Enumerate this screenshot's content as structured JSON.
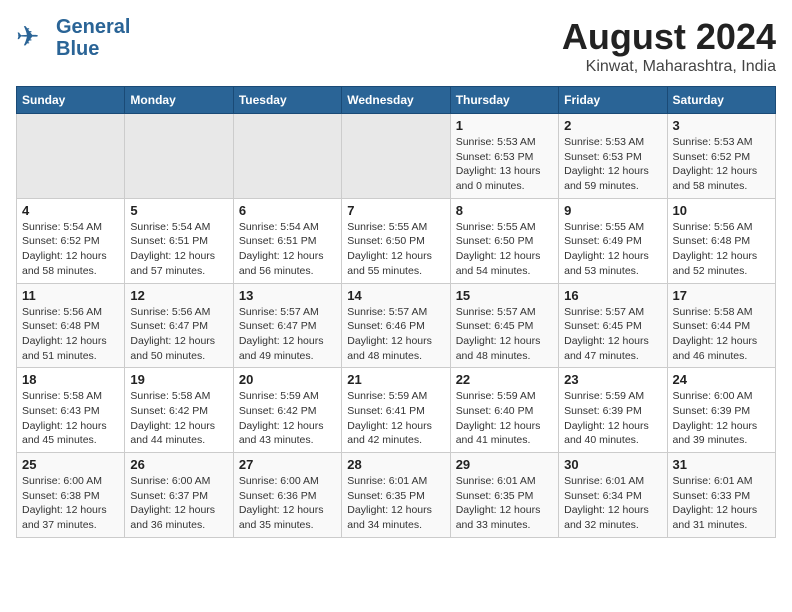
{
  "logo": {
    "line1": "General",
    "line2": "Blue"
  },
  "title": "August 2024",
  "subtitle": "Kinwat, Maharashtra, India",
  "weekdays": [
    "Sunday",
    "Monday",
    "Tuesday",
    "Wednesday",
    "Thursday",
    "Friday",
    "Saturday"
  ],
  "weeks": [
    [
      {
        "day": "",
        "info": ""
      },
      {
        "day": "",
        "info": ""
      },
      {
        "day": "",
        "info": ""
      },
      {
        "day": "",
        "info": ""
      },
      {
        "day": "1",
        "info": "Sunrise: 5:53 AM\nSunset: 6:53 PM\nDaylight: 13 hours\nand 0 minutes."
      },
      {
        "day": "2",
        "info": "Sunrise: 5:53 AM\nSunset: 6:53 PM\nDaylight: 12 hours\nand 59 minutes."
      },
      {
        "day": "3",
        "info": "Sunrise: 5:53 AM\nSunset: 6:52 PM\nDaylight: 12 hours\nand 58 minutes."
      }
    ],
    [
      {
        "day": "4",
        "info": "Sunrise: 5:54 AM\nSunset: 6:52 PM\nDaylight: 12 hours\nand 58 minutes."
      },
      {
        "day": "5",
        "info": "Sunrise: 5:54 AM\nSunset: 6:51 PM\nDaylight: 12 hours\nand 57 minutes."
      },
      {
        "day": "6",
        "info": "Sunrise: 5:54 AM\nSunset: 6:51 PM\nDaylight: 12 hours\nand 56 minutes."
      },
      {
        "day": "7",
        "info": "Sunrise: 5:55 AM\nSunset: 6:50 PM\nDaylight: 12 hours\nand 55 minutes."
      },
      {
        "day": "8",
        "info": "Sunrise: 5:55 AM\nSunset: 6:50 PM\nDaylight: 12 hours\nand 54 minutes."
      },
      {
        "day": "9",
        "info": "Sunrise: 5:55 AM\nSunset: 6:49 PM\nDaylight: 12 hours\nand 53 minutes."
      },
      {
        "day": "10",
        "info": "Sunrise: 5:56 AM\nSunset: 6:48 PM\nDaylight: 12 hours\nand 52 minutes."
      }
    ],
    [
      {
        "day": "11",
        "info": "Sunrise: 5:56 AM\nSunset: 6:48 PM\nDaylight: 12 hours\nand 51 minutes."
      },
      {
        "day": "12",
        "info": "Sunrise: 5:56 AM\nSunset: 6:47 PM\nDaylight: 12 hours\nand 50 minutes."
      },
      {
        "day": "13",
        "info": "Sunrise: 5:57 AM\nSunset: 6:47 PM\nDaylight: 12 hours\nand 49 minutes."
      },
      {
        "day": "14",
        "info": "Sunrise: 5:57 AM\nSunset: 6:46 PM\nDaylight: 12 hours\nand 48 minutes."
      },
      {
        "day": "15",
        "info": "Sunrise: 5:57 AM\nSunset: 6:45 PM\nDaylight: 12 hours\nand 48 minutes."
      },
      {
        "day": "16",
        "info": "Sunrise: 5:57 AM\nSunset: 6:45 PM\nDaylight: 12 hours\nand 47 minutes."
      },
      {
        "day": "17",
        "info": "Sunrise: 5:58 AM\nSunset: 6:44 PM\nDaylight: 12 hours\nand 46 minutes."
      }
    ],
    [
      {
        "day": "18",
        "info": "Sunrise: 5:58 AM\nSunset: 6:43 PM\nDaylight: 12 hours\nand 45 minutes."
      },
      {
        "day": "19",
        "info": "Sunrise: 5:58 AM\nSunset: 6:42 PM\nDaylight: 12 hours\nand 44 minutes."
      },
      {
        "day": "20",
        "info": "Sunrise: 5:59 AM\nSunset: 6:42 PM\nDaylight: 12 hours\nand 43 minutes."
      },
      {
        "day": "21",
        "info": "Sunrise: 5:59 AM\nSunset: 6:41 PM\nDaylight: 12 hours\nand 42 minutes."
      },
      {
        "day": "22",
        "info": "Sunrise: 5:59 AM\nSunset: 6:40 PM\nDaylight: 12 hours\nand 41 minutes."
      },
      {
        "day": "23",
        "info": "Sunrise: 5:59 AM\nSunset: 6:39 PM\nDaylight: 12 hours\nand 40 minutes."
      },
      {
        "day": "24",
        "info": "Sunrise: 6:00 AM\nSunset: 6:39 PM\nDaylight: 12 hours\nand 39 minutes."
      }
    ],
    [
      {
        "day": "25",
        "info": "Sunrise: 6:00 AM\nSunset: 6:38 PM\nDaylight: 12 hours\nand 37 minutes."
      },
      {
        "day": "26",
        "info": "Sunrise: 6:00 AM\nSunset: 6:37 PM\nDaylight: 12 hours\nand 36 minutes."
      },
      {
        "day": "27",
        "info": "Sunrise: 6:00 AM\nSunset: 6:36 PM\nDaylight: 12 hours\nand 35 minutes."
      },
      {
        "day": "28",
        "info": "Sunrise: 6:01 AM\nSunset: 6:35 PM\nDaylight: 12 hours\nand 34 minutes."
      },
      {
        "day": "29",
        "info": "Sunrise: 6:01 AM\nSunset: 6:35 PM\nDaylight: 12 hours\nand 33 minutes."
      },
      {
        "day": "30",
        "info": "Sunrise: 6:01 AM\nSunset: 6:34 PM\nDaylight: 12 hours\nand 32 minutes."
      },
      {
        "day": "31",
        "info": "Sunrise: 6:01 AM\nSunset: 6:33 PM\nDaylight: 12 hours\nand 31 minutes."
      }
    ]
  ]
}
